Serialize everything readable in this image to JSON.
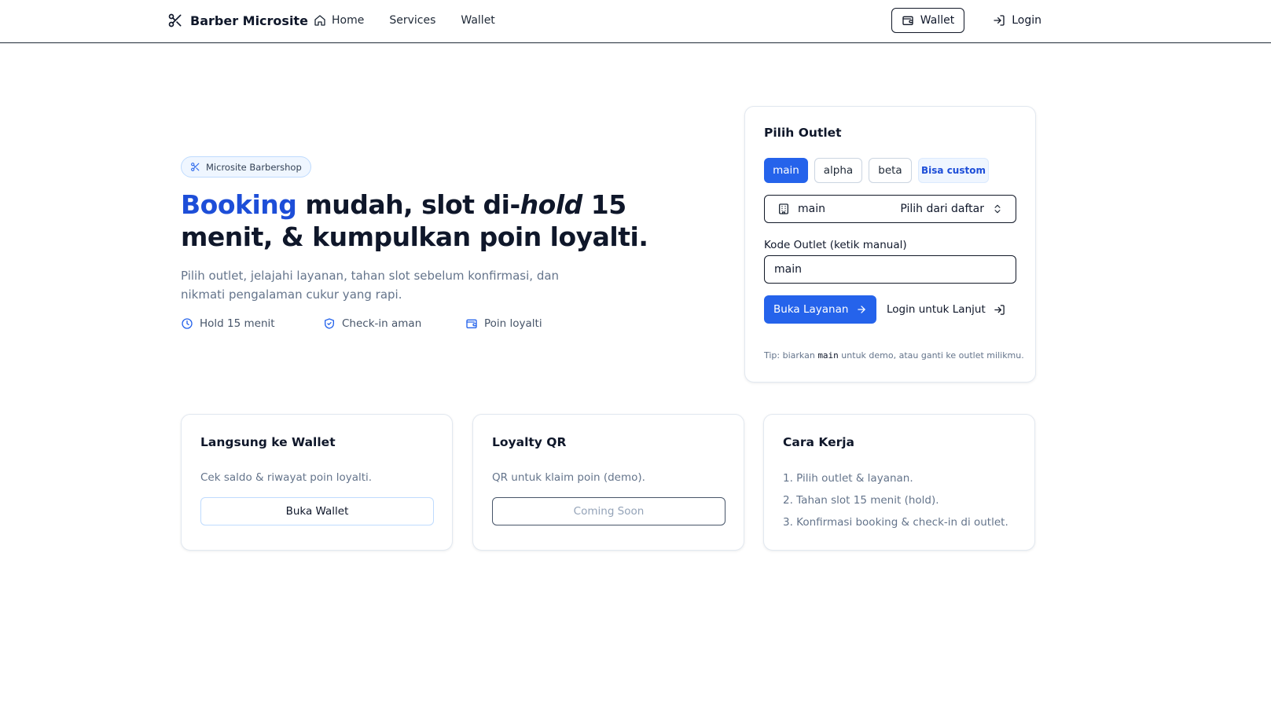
{
  "nav": {
    "brand": "Barber Microsite",
    "links": [
      {
        "label": "Home",
        "icon": "home-icon"
      },
      {
        "label": "Services"
      },
      {
        "label": "Wallet"
      }
    ],
    "wallet_button": "Wallet",
    "login": "Login"
  },
  "hero": {
    "badge": "Microsite Barbershop",
    "title_accent": "Booking",
    "title_part1": " mudah, slot di-",
    "title_italic": "hold",
    "title_part2": " 15 menit, & kumpulkan poin loyalti.",
    "subtitle": "Pilih outlet, jelajahi layanan, tahan slot sebelum konfirmasi, dan nikmati pengalaman cukur yang rapi.",
    "features": [
      {
        "label": "Hold 15 menit",
        "icon": "clock-icon"
      },
      {
        "label": "Check-in aman",
        "icon": "shield-check-icon"
      },
      {
        "label": "Poin loyalti",
        "icon": "wallet-icon"
      }
    ]
  },
  "outlet": {
    "title": "Pilih Outlet",
    "chips": [
      "main",
      "alpha",
      "beta"
    ],
    "active_chip": "main",
    "custom_badge": "Bisa custom",
    "select_value": "main",
    "select_hint": "Pilih dari daftar",
    "code_label": "Kode Outlet (ketik manual)",
    "code_value": "main",
    "primary_button": "Buka Layanan",
    "secondary_button": "Login untuk Lanjut",
    "tip_prefix": "Tip: biarkan ",
    "tip_code": "main",
    "tip_suffix": " untuk demo, atau ganti ke outlet milikmu."
  },
  "cards": [
    {
      "title": "Langsung ke Wallet",
      "desc": "Cek saldo & riwayat poin loyalti.",
      "button": "Buka Wallet"
    },
    {
      "title": "Loyalty QR",
      "desc": "QR untuk klaim poin (demo).",
      "button": "Coming Soon"
    },
    {
      "title": "Cara Kerja",
      "steps": [
        "1. Pilih outlet & layanan.",
        "2. Tahan slot 15 menit (hold).",
        "3. Konfirmasi booking & check-in di outlet."
      ]
    }
  ],
  "colors": {
    "primary": "#2563eb",
    "accent_text": "#1d4ed8",
    "text": "#0f172a",
    "muted": "#64748b",
    "border": "#e2e8f0"
  }
}
